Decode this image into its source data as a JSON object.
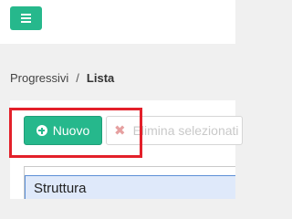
{
  "breadcrumb": {
    "parent": "Progressivi",
    "separator": "/",
    "current": "Lista"
  },
  "toolbar": {
    "new_label": "Nuovo",
    "delete_label": "Elimina selezionati"
  },
  "table": {
    "columns": [
      "Struttura"
    ]
  },
  "colors": {
    "accent": "#26b88c",
    "highlight": "#e3202a",
    "header_bg": "#dfe9fa"
  }
}
